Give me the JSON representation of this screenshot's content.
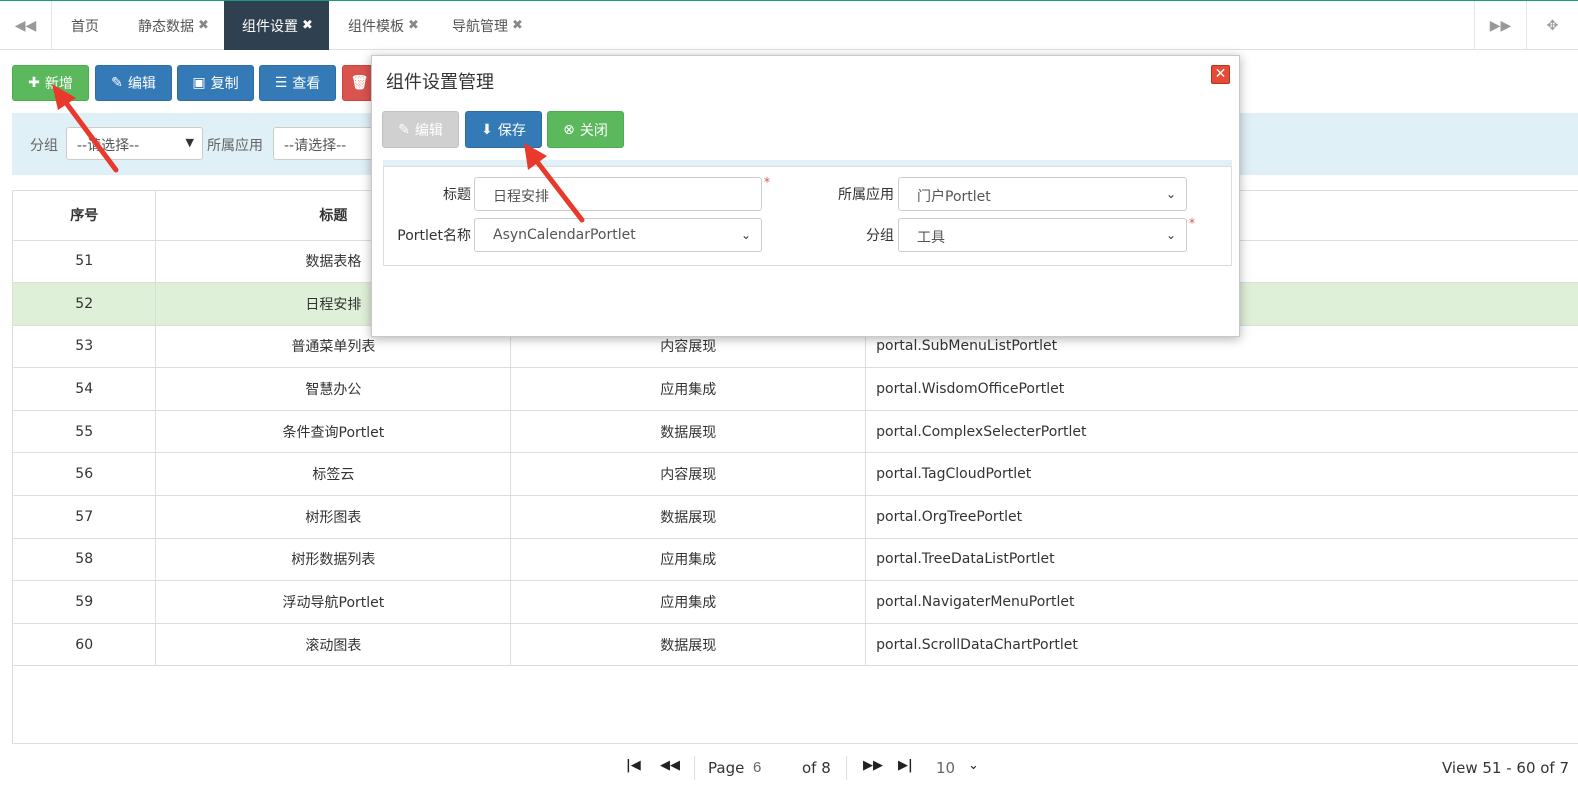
{
  "tabs": {
    "items": [
      {
        "label": "首页",
        "closable": false
      },
      {
        "label": "静态数据",
        "closable": true
      },
      {
        "label": "组件设置",
        "closable": true,
        "active": true
      },
      {
        "label": "组件模板",
        "closable": true
      },
      {
        "label": "导航管理",
        "closable": true
      }
    ],
    "close_glyph": "✖"
  },
  "toolbar": {
    "add": "新增",
    "edit": "编辑",
    "copy": "复制",
    "view": "查看"
  },
  "filter": {
    "group_label": "分组",
    "group_value": "--请选择--",
    "app_label": "所属应用",
    "app_value": "--请选择--"
  },
  "table": {
    "headers": [
      "序号",
      "标题",
      "",
      ""
    ],
    "rows": [
      {
        "no": "51",
        "title": "数据表格",
        "type": "",
        "code": ""
      },
      {
        "no": "52",
        "title": "日程安排",
        "type": "",
        "code": "",
        "selected": true
      },
      {
        "no": "53",
        "title": "普通菜单列表",
        "type": "内容展现",
        "code": "portal.SubMenuListPortlet"
      },
      {
        "no": "54",
        "title": "智慧办公",
        "type": "应用集成",
        "code": "portal.WisdomOfficePortlet"
      },
      {
        "no": "55",
        "title": "条件查询Portlet",
        "type": "数据展现",
        "code": "portal.ComplexSelecterPortlet"
      },
      {
        "no": "56",
        "title": "标签云",
        "type": "内容展现",
        "code": "portal.TagCloudPortlet"
      },
      {
        "no": "57",
        "title": "树形图表",
        "type": "数据展现",
        "code": "portal.OrgTreePortlet"
      },
      {
        "no": "58",
        "title": "树形数据列表",
        "type": "应用集成",
        "code": "portal.TreeDataListPortlet"
      },
      {
        "no": "59",
        "title": "浮动导航Portlet",
        "type": "应用集成",
        "code": "portal.NavigaterMenuPortlet"
      },
      {
        "no": "60",
        "title": "滚动图表",
        "type": "数据展现",
        "code": "portal.ScrollDataChartPortlet"
      }
    ]
  },
  "pager": {
    "page_label": "Page",
    "page_value": "6",
    "of_label": "of 8",
    "page_size": "10",
    "view_text": "View 51 - 60 of 7"
  },
  "modal": {
    "title": "组件设置管理",
    "edit_label": "编辑",
    "save_label": "保存",
    "close_label": "关闭",
    "form": {
      "title_label": "标题",
      "title_value": "日程安排",
      "app_label": "所属应用",
      "app_value": "门户Portlet",
      "portlet_label": "Portlet名称",
      "portlet_value": "AsynCalendarPortlet",
      "group_label": "分组",
      "group_value": "工具",
      "required_mark": "*"
    }
  },
  "colors": {
    "accent_green": "#5cb85c",
    "primary_blue": "#337ab7",
    "danger_red": "#d9534f",
    "active_tab": "#2f4050",
    "panel_bg": "#dff0f6",
    "selected_row": "#dff0d8",
    "annotation_arrow": "#e8392c"
  },
  "icons": [
    "backward-icon",
    "forward-icon",
    "fullscreen-icon",
    "plus-icon",
    "edit-icon",
    "copy-icon",
    "list-icon",
    "trash-icon",
    "download-icon",
    "close-circle-icon",
    "first-page-icon",
    "prev-page-icon",
    "next-page-icon",
    "last-page-icon"
  ]
}
